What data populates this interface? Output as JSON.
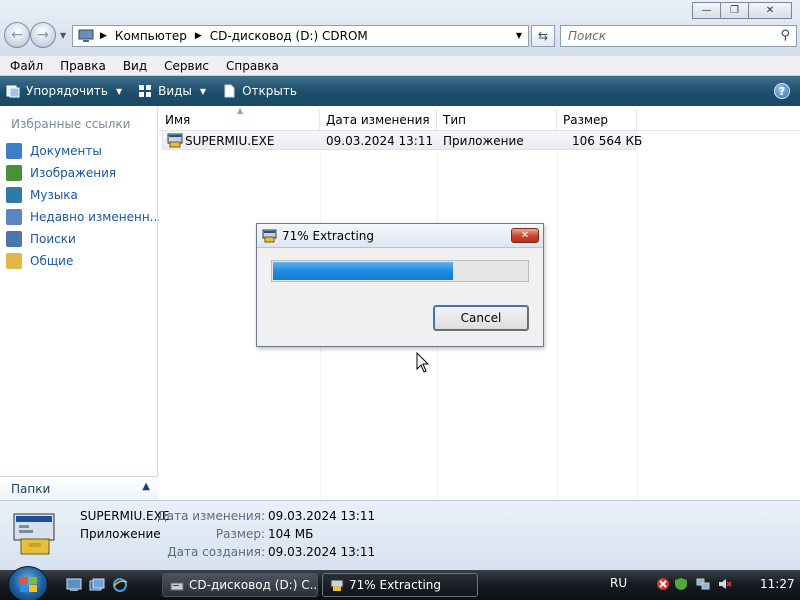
{
  "window": {
    "buttons": {
      "minimize": "—",
      "maximize": "❐",
      "close": "✕"
    }
  },
  "address": {
    "crumbs": [
      "Компьютер",
      "CD-дисковод (D:) CDROM"
    ],
    "search_placeholder": "Поиск"
  },
  "menu": [
    "Файл",
    "Правка",
    "Вид",
    "Сервис",
    "Справка"
  ],
  "toolbar": {
    "organize": "Упорядочить",
    "views": "Виды",
    "open": "Открыть",
    "help": "?"
  },
  "favorites": {
    "title": "Избранные ссылки",
    "items": [
      {
        "label": "Документы",
        "icon": "documents-icon",
        "color": "#3d7ec9"
      },
      {
        "label": "Изображения",
        "icon": "pictures-icon",
        "color": "#4a8f3a"
      },
      {
        "label": "Музыка",
        "icon": "music-icon",
        "color": "#2e7aa8"
      },
      {
        "label": "Недавно измененн...",
        "icon": "recent-icon",
        "color": "#5b86c2"
      },
      {
        "label": "Поиски",
        "icon": "searches-icon",
        "color": "#4a76ad"
      },
      {
        "label": "Общие",
        "icon": "public-folder-icon",
        "color": "#e0b84a"
      }
    ],
    "folders_label": "Папки"
  },
  "columns": [
    "Имя",
    "Дата изменения",
    "Тип",
    "Размер"
  ],
  "files": [
    {
      "name": "SUPERMIU.EXE",
      "modified": "09.03.2024 13:11",
      "type": "Приложение",
      "size": "106 564 КБ"
    }
  ],
  "details": {
    "name": "SUPERMIU.EXE",
    "type": "Приложение",
    "modified_label": "Дата изменения:",
    "modified": "09.03.2024 13:11",
    "size_label": "Размер:",
    "size": "104 МБ",
    "created_label": "Дата создания:",
    "created": "09.03.2024 13:11"
  },
  "dialog": {
    "title": "71% Extracting",
    "progress": 0.71,
    "cancel": "Cancel",
    "close": "✕"
  },
  "taskbar": {
    "tasks": [
      "CD-дисковод (D:) C...",
      "71% Extracting"
    ],
    "lang": "RU",
    "clock": "11:27"
  },
  "colors": {
    "accent_link": "#1a56a8",
    "progress": "#1e8ae0",
    "command_bar": "#1c4d6b"
  }
}
